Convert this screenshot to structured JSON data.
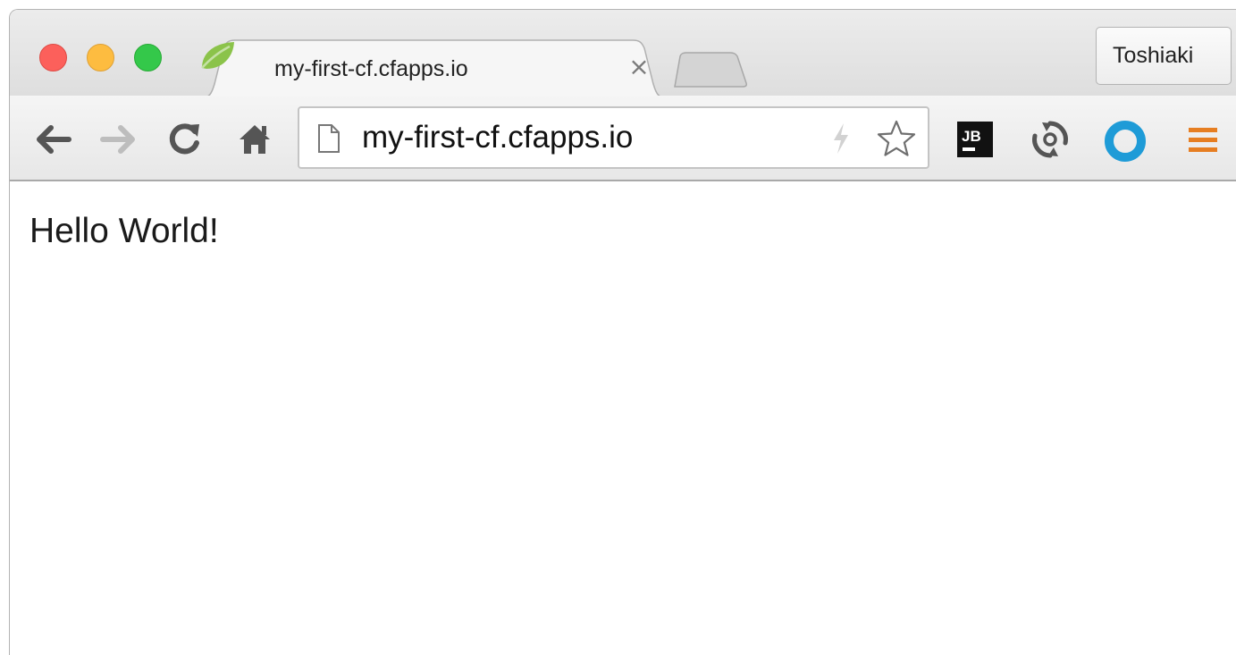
{
  "tab": {
    "title": "my-first-cf.cfapps.io",
    "close_glyph": "×",
    "favicon": "spring-leaf-icon"
  },
  "profile": {
    "name": "Toshiaki"
  },
  "toolbar": {
    "url": "my-first-cf.cfapps.io",
    "extensions": [
      "jetbrains-ide-support-icon",
      "sync-icon",
      "blue-circle-extension-icon"
    ],
    "menu_icon": "hamburger-menu-icon"
  },
  "colors": {
    "traffic_close": "#fc605b",
    "traffic_minimize": "#fdbc40",
    "traffic_maximize": "#34c84a",
    "menu_accent": "#e67e22",
    "extension_blue": "#1e9bd7",
    "favicon_green": "#7cb342"
  },
  "page": {
    "body_text": "Hello World!"
  }
}
